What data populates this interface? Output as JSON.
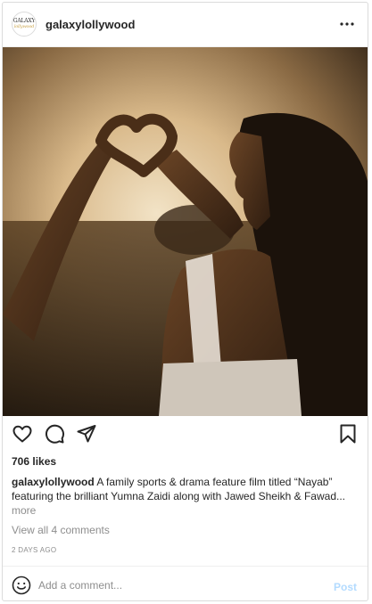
{
  "post": {
    "username": "galaxylollywood",
    "avatar_text": "GALAXY",
    "avatar_subtext": "lollywood",
    "likes": "706 likes",
    "caption_user": "galaxylollywood",
    "caption_text": "A family sports & drama feature film titled “Nayab” featuring the brilliant Yumna Zaidi along with Jawed Sheikh & Fawad",
    "caption_ellipsis": "...",
    "caption_more": "more",
    "view_comments": "View all 4 comments",
    "timestamp": "2 DAYS AGO"
  },
  "comment_box": {
    "placeholder": "Add a comment...",
    "post_label": "Post"
  },
  "icons": {
    "more": "more-options-icon",
    "like": "heart-icon",
    "comment": "comment-icon",
    "share": "share-icon",
    "save": "bookmark-icon",
    "emoji": "emoji-icon"
  },
  "colors": {
    "text": "#262626",
    "muted": "#8e8e8e",
    "post_disabled": "#b3dbff",
    "border": "#dbdbdb"
  }
}
